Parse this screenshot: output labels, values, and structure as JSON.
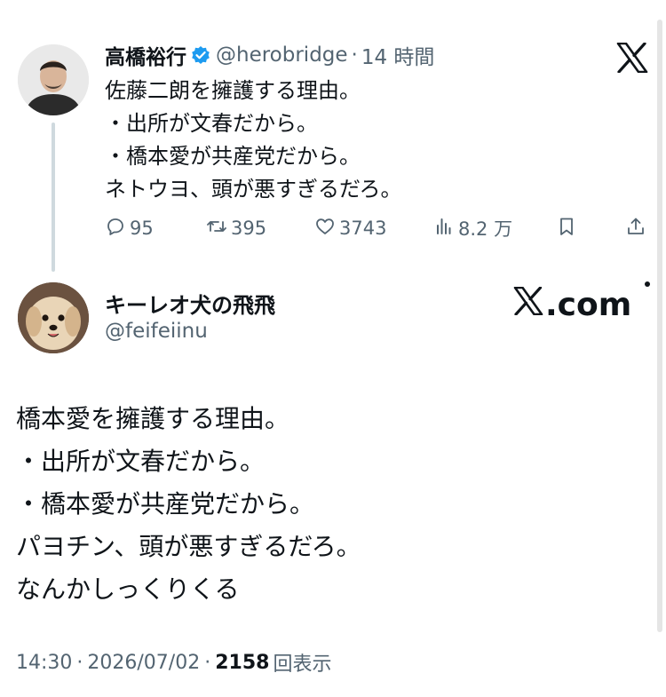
{
  "quoted_tweet": {
    "display_name": "高橋裕行",
    "handle": "@herobridge",
    "separator": "·",
    "time_ago": "14 時間",
    "body_lines": [
      "佐藤二朗を擁護する理由。",
      "・出所が文春だから。",
      "・橋本愛が共産党だから。",
      "ネトウヨ、頭が悪すぎるだろ。"
    ],
    "actions": {
      "reply_count": "95",
      "retweet_count": "395",
      "like_count": "3743",
      "view_count": "8.2 万"
    },
    "icons": [
      "avatar",
      "verified-badge-icon",
      "x-logo-icon",
      "reply-icon",
      "retweet-icon",
      "like-icon",
      "views-icon",
      "bookmark-icon",
      "share-icon"
    ]
  },
  "tweet": {
    "display_name": "キーレオ犬の飛飛",
    "handle": "@feifeiinu",
    "brand_label": ".com",
    "body_lines": [
      "橋本愛を擁護する理由。",
      "・出所が文春だから。",
      "・橋本愛が共産党だから。",
      "パヨチン、頭が悪すぎるだろ。",
      "なんかしっくりくる"
    ],
    "time": "14:30",
    "separator": "·",
    "date": "2026/07/02",
    "views_count": "2158",
    "views_label": "回表示"
  },
  "colors": {
    "text_primary": "#0f1419",
    "text_secondary": "#536471",
    "verified_blue": "#1d9bf0",
    "thread_line": "#cfd9de"
  }
}
